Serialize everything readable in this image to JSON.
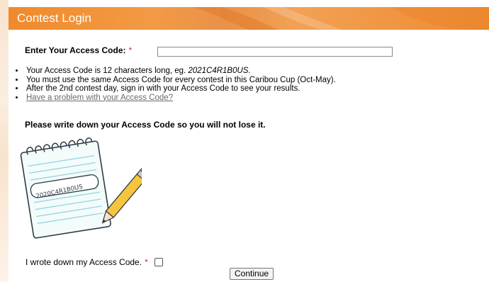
{
  "header": {
    "title": "Contest Login"
  },
  "form": {
    "access_label": "Enter Your Access Code:",
    "required_mark": "*",
    "access_value": "",
    "access_placeholder": ""
  },
  "info": {
    "item1_pre": "Your Access Code is 12 characters long, eg. ",
    "item1_example": "2021C4R1B0US.",
    "item2": "You must use the same Access Code for every contest in this Caribou Cup (Oct-May).",
    "item3": "After the 2nd contest day, sign in with your Access Code to see your results.",
    "item4_link": "Have a problem with your Access Code?"
  },
  "warning": "Please write down your Access Code so you will not lose it.",
  "illustration": {
    "notepad_code": "2020C4R1B0US"
  },
  "confirm": {
    "label": "I wrote down my Access Code.",
    "checked": false
  },
  "continue_label": "Continue",
  "colors": {
    "header_orange": "#f08a2c",
    "required_red": "#d9262b",
    "link_gray": "#6b6b6b"
  }
}
